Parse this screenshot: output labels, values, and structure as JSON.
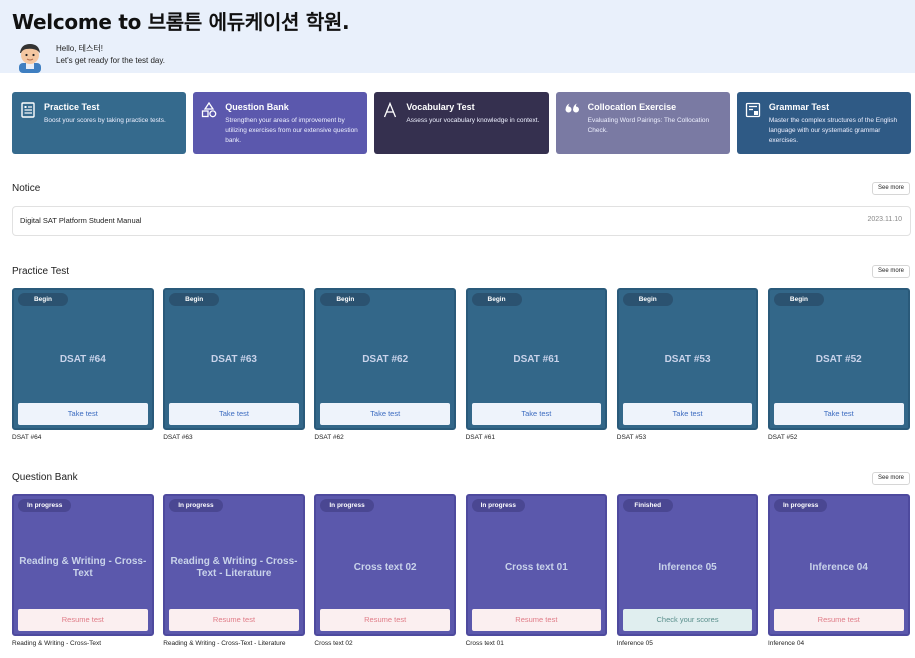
{
  "header": {
    "title": "Welcome to 브롬튼 에듀케이션 학원.",
    "greeting": "Hello, 테스터!",
    "subtitle": "Let's get ready for the test day."
  },
  "features": [
    {
      "title": "Practice Test",
      "desc": "Boost your scores by taking practice tests.",
      "icon": "document-list-icon",
      "color": "#356a8d"
    },
    {
      "title": "Question Bank",
      "desc": "Strengthen your areas of improvement by utilizing exercises from our extensive question bank.",
      "icon": "shapes-icon",
      "color": "#5b58ad"
    },
    {
      "title": "Vocabulary Test",
      "desc": "Assess your vocabulary knowledge in context.",
      "icon": "letter-a-icon",
      "color": "#35304f"
    },
    {
      "title": "Collocation Exercise",
      "desc": "Evaluating Word Pairings: The Collocation Check.",
      "icon": "quote-icon",
      "color": "#7a7aa3"
    },
    {
      "title": "Grammar Test",
      "desc": "Master the complex structures of the English language with our systematic grammar exercises.",
      "icon": "book-icon",
      "color": "#2f5a85"
    }
  ],
  "notice": {
    "heading": "Notice",
    "see_more": "See more",
    "items": [
      {
        "title": "Digital SAT Platform Student Manual",
        "date": "2023.11.10"
      }
    ]
  },
  "practice_test": {
    "heading": "Practice Test",
    "see_more": "See more",
    "cards": [
      {
        "badge": "Begin",
        "name": "DSAT #64",
        "button": "Take test",
        "caption": "DSAT #64"
      },
      {
        "badge": "Begin",
        "name": "DSAT #63",
        "button": "Take test",
        "caption": "DSAT #63"
      },
      {
        "badge": "Begin",
        "name": "DSAT #62",
        "button": "Take test",
        "caption": "DSAT #62"
      },
      {
        "badge": "Begin",
        "name": "DSAT #61",
        "button": "Take test",
        "caption": "DSAT #61"
      },
      {
        "badge": "Begin",
        "name": "DSAT #53",
        "button": "Take test",
        "caption": "DSAT #53"
      },
      {
        "badge": "Begin",
        "name": "DSAT #52",
        "button": "Take test",
        "caption": "DSAT #52"
      }
    ]
  },
  "question_bank": {
    "heading": "Question Bank",
    "see_more": "See more",
    "cards": [
      {
        "badge": "In progress",
        "name": "Reading & Writing - Cross-Text",
        "button": "Resume test",
        "caption": "Reading & Writing - Cross-Text"
      },
      {
        "badge": "In progress",
        "name": "Reading & Writing - Cross-Text - Literature",
        "button": "Resume test",
        "caption": "Reading & Writing - Cross-Text - Literature"
      },
      {
        "badge": "In progress",
        "name": "Cross text 02",
        "button": "Resume test",
        "caption": "Cross text 02"
      },
      {
        "badge": "In progress",
        "name": "Cross text 01",
        "button": "Resume test",
        "caption": "Cross text 01"
      },
      {
        "badge": "Finished",
        "name": "Inference 05",
        "button": "Check your scores",
        "caption": "Inference 05"
      },
      {
        "badge": "In progress",
        "name": "Inference 04",
        "button": "Resume test",
        "caption": "Inference 04"
      }
    ]
  }
}
